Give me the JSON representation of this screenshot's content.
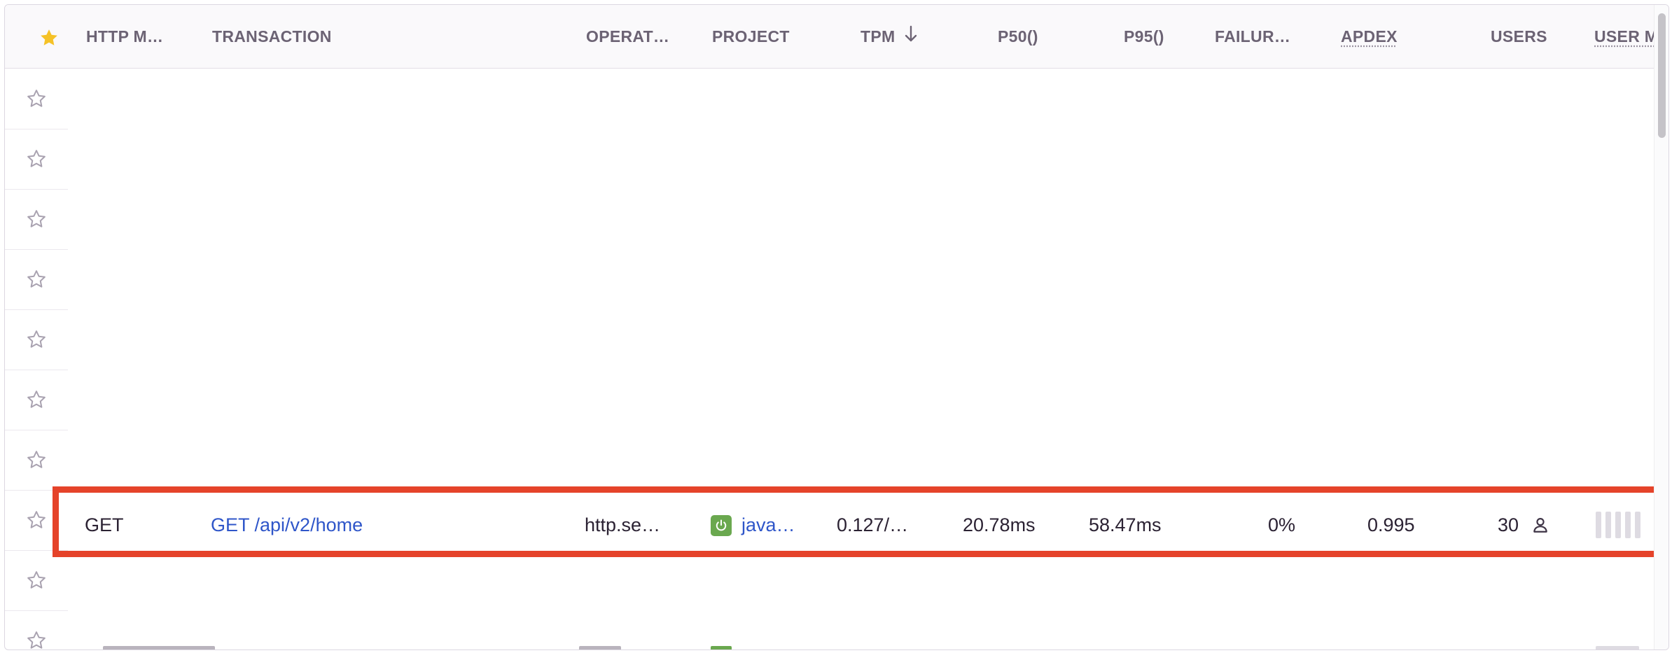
{
  "header": {
    "star_icon": "star-filled-icon",
    "columns": [
      {
        "label": "HTTP M…"
      },
      {
        "label": "TRANSACTION"
      },
      {
        "label": "OPERAT…"
      },
      {
        "label": "PROJECT"
      },
      {
        "label": "TPM"
      },
      {
        "label": "P50()"
      },
      {
        "label": "P95()"
      },
      {
        "label": "FAILUR…"
      },
      {
        "label": "APDEX"
      },
      {
        "label": "USERS"
      },
      {
        "label": "USER M"
      }
    ],
    "sort_icon": "arrow-down-icon"
  },
  "rows": [
    {
      "http_method": "GET",
      "transaction": "GET /api/v2/home",
      "operation": "http.se…",
      "project": "java…",
      "project_icon": "power-icon",
      "tpm": "0.127/…",
      "p50": "20.78ms",
      "p95": "58.47ms",
      "failure_rate": "0%",
      "apdex": "0.995",
      "users": "30",
      "users_icon": "user-icon"
    }
  ],
  "colors": {
    "accent_star": "#f5c227",
    "link": "#2f56c9",
    "highlight": "#e5432a",
    "project_badge": "#6aa84f"
  }
}
